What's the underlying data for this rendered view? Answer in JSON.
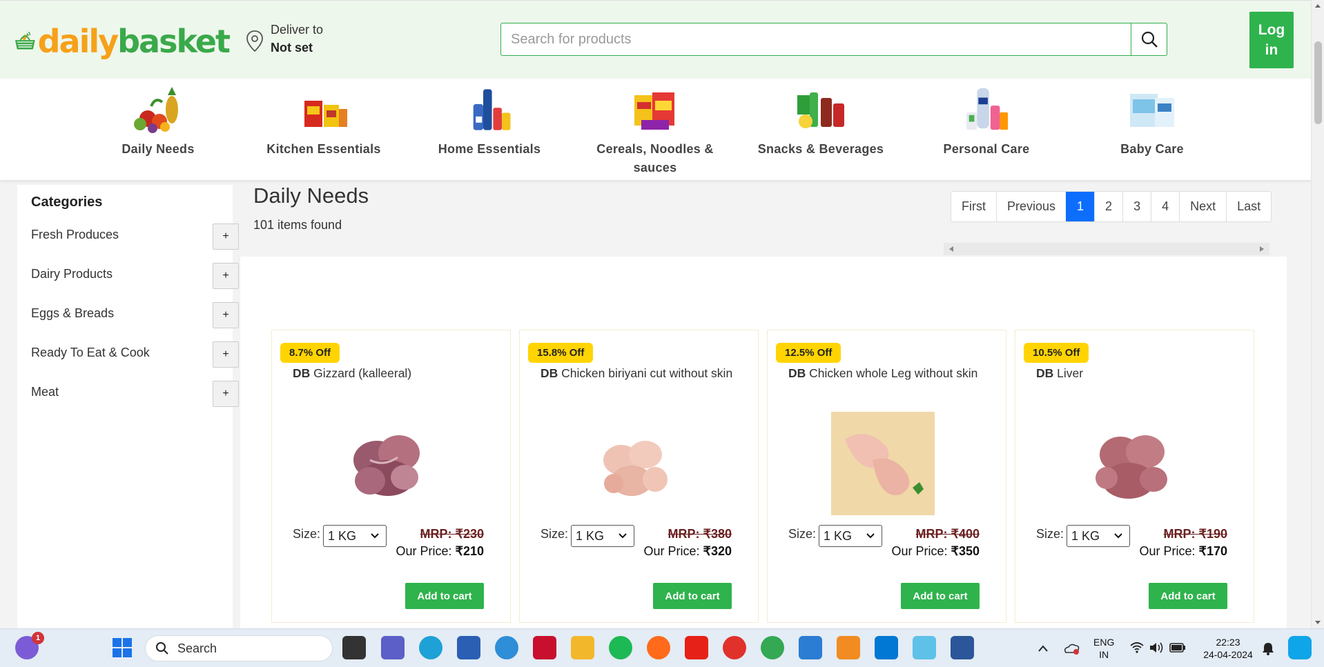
{
  "brand": {
    "part1": "daily",
    "part2": "basket"
  },
  "deliver": {
    "line1": "Deliver to",
    "line2": "Not set"
  },
  "search": {
    "placeholder": "Search for products"
  },
  "login_label": "Log in",
  "categories_bar": [
    {
      "label": "Daily Needs",
      "icon": "fruits-veg-icon"
    },
    {
      "label": "Kitchen Essentials",
      "icon": "spices-icon"
    },
    {
      "label": "Home Essentials",
      "icon": "cleaning-bottles-icon"
    },
    {
      "label": "Cereals, Noodles & sauces",
      "icon": "noodles-pack-icon"
    },
    {
      "label": "Snacks & Beverages",
      "icon": "snacks-drinks-icon"
    },
    {
      "label": "Personal Care",
      "icon": "personal-care-icon"
    },
    {
      "label": "Baby Care",
      "icon": "diapers-icon"
    }
  ],
  "sidebar": {
    "title": "Categories",
    "items": [
      {
        "label": "Fresh Produces",
        "toggle": "+"
      },
      {
        "label": "Dairy Products",
        "toggle": "+"
      },
      {
        "label": "Eggs & Breads",
        "toggle": "+"
      },
      {
        "label": "Ready To Eat & Cook",
        "toggle": "+"
      },
      {
        "label": "Meat",
        "toggle": "+"
      }
    ]
  },
  "main": {
    "title": "Daily Needs",
    "items_found": "101 items found"
  },
  "pagination": {
    "first": "First",
    "previous": "Previous",
    "pages": [
      "1",
      "2",
      "3",
      "4"
    ],
    "active": "1",
    "next": "Next",
    "last": "Last"
  },
  "products": [
    {
      "badge": "8.7% Off",
      "brand": "DB",
      "name": "Gizzard (kalleeral)",
      "size_label": "Size:",
      "size": "1 KG",
      "mrp": "MRP: ₹230",
      "price_label": "Our Price:",
      "price": "₹210",
      "cart": "Add to cart"
    },
    {
      "badge": "15.8% Off",
      "brand": "DB",
      "name": "Chicken biriyani cut without skin",
      "size_label": "Size:",
      "size": "1 KG",
      "mrp": "MRP: ₹380",
      "price_label": "Our Price:",
      "price": "₹320",
      "cart": "Add to cart"
    },
    {
      "badge": "12.5% Off",
      "brand": "DB",
      "name": "Chicken whole Leg without skin",
      "size_label": "Size:",
      "size": "1 KG",
      "mrp": "MRP: ₹400",
      "price_label": "Our Price:",
      "price": "₹350",
      "cart": "Add to cart"
    },
    {
      "badge": "10.5% Off",
      "brand": "DB",
      "name": "Liver",
      "size_label": "Size:",
      "size": "1 KG",
      "mrp": "MRP: ₹190",
      "price_label": "Our Price:",
      "price": "₹170",
      "cart": "Add to cart"
    }
  ],
  "taskbar": {
    "search_label": "Search",
    "notification_count": "1",
    "lang": "ENG",
    "region": "IN",
    "time": "22:23",
    "date": "24-04-2024"
  },
  "colors": {
    "accent": "#2fb34d",
    "badge": "#ffd400",
    "active_page": "#0d6efd",
    "brand_orange": "#f6a11a"
  }
}
